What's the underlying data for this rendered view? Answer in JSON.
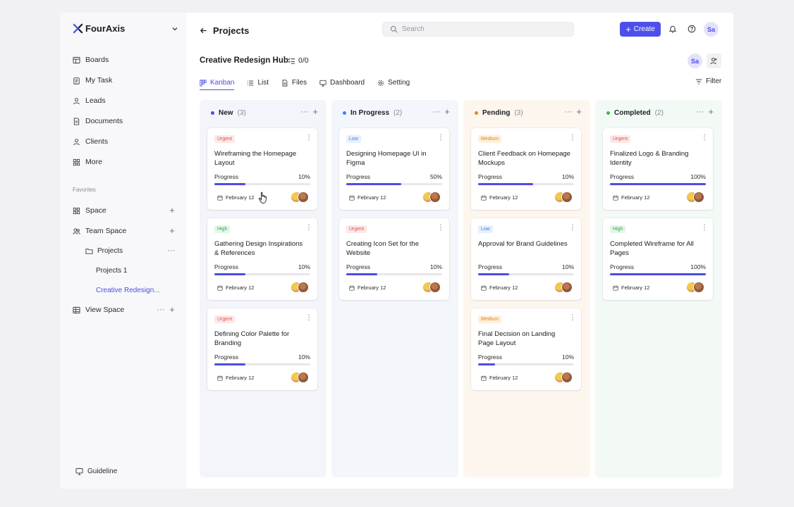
{
  "brand": {
    "name": "FourAxis"
  },
  "sidebar": {
    "items": [
      {
        "label": "Boards",
        "icon": "board-icon"
      },
      {
        "label": "My Task",
        "icon": "clipboard-icon"
      },
      {
        "label": "Leads",
        "icon": "user-icon"
      },
      {
        "label": "Documents",
        "icon": "document-icon"
      },
      {
        "label": "Clients",
        "icon": "user-icon"
      },
      {
        "label": "More",
        "icon": "grid-icon"
      }
    ],
    "favorites_label": "Favorites",
    "space": "Space",
    "team_space": "Team Space",
    "projects_folder": "Projects",
    "projects_1": "Projects 1",
    "active_project": "Creative Redesign...",
    "view_space": "View Space",
    "guideline": "Guideline"
  },
  "header": {
    "back_title": "Projects",
    "search_placeholder": "Search",
    "create_label": "Create",
    "user_initials": "Sa"
  },
  "project": {
    "title": "Creative Redesign Hub",
    "task_count": "0/0",
    "member_initials": "Sa"
  },
  "tabs": [
    {
      "label": "Kanban",
      "active": true
    },
    {
      "label": "List",
      "active": false
    },
    {
      "label": "Files",
      "active": false
    },
    {
      "label": "Dashboard",
      "active": false
    },
    {
      "label": "Setting",
      "active": false
    }
  ],
  "filter_label": "Filter",
  "colors": {
    "accent": "#4b4de0",
    "new": "#4b4de0",
    "in_progress": "#3b82f6",
    "pending": "#e08a1e",
    "completed": "#3fb950",
    "urgent_bg": "#fde8e8",
    "urgent_fg": "#e0524f",
    "high_bg": "#e4f6e7",
    "high_fg": "#34a853",
    "medium_bg": "#fdf0dc",
    "medium_fg": "#d9861a",
    "low_bg": "#e6f0fd",
    "low_fg": "#3b7de0"
  },
  "columns": [
    {
      "name": "New",
      "count": "(3)",
      "cards": [
        {
          "priority": "Urgent",
          "title": "Wireframing the Homepage Layout",
          "progress_label": "Progress",
          "progress": "10%",
          "progress_value": 0.32,
          "date": "February 12"
        },
        {
          "priority": "High",
          "title": "Gathering Design Inspirations & References",
          "progress_label": "Progress",
          "progress": "10%",
          "progress_value": 0.32,
          "date": "February 12"
        },
        {
          "priority": "Urgent",
          "title": "Defining Color Palette for Branding",
          "progress_label": "Progress",
          "progress": "10%",
          "progress_value": 0.32,
          "date": "February 12"
        }
      ]
    },
    {
      "name": "In Progress",
      "count": "(2)",
      "cards": [
        {
          "priority": "Low",
          "title": "Designing Homepage UI in Figma",
          "progress_label": "Progress",
          "progress": "50%",
          "progress_value": 0.57,
          "date": "February 12"
        },
        {
          "priority": "Urgent",
          "title": "Creating Icon Set for the Website",
          "progress_label": "Progress",
          "progress": "10%",
          "progress_value": 0.32,
          "date": "February 12"
        }
      ]
    },
    {
      "name": "Pending",
      "count": "(3)",
      "cards": [
        {
          "priority": "Medium",
          "title": "Client Feedback on Homepage Mockups",
          "progress_label": "Progress",
          "progress": "10%",
          "progress_value": 0.57,
          "date": "February 12"
        },
        {
          "priority": "Low",
          "title": "Approval for Brand Guidelines",
          "progress_label": "Progress",
          "progress": "10%",
          "progress_value": 0.32,
          "date": "February 12"
        },
        {
          "priority": "Medium",
          "title": "Final Decision on Landing Page Layout",
          "progress_label": "Progress",
          "progress": "10%",
          "progress_value": 0.18,
          "date": "February 12"
        }
      ]
    },
    {
      "name": "Completed",
      "count": "(2)",
      "cards": [
        {
          "priority": "Urgent",
          "title": "Finalized Logo & Branding Identity",
          "progress_label": "Progress",
          "progress": "100%",
          "progress_value": 1.0,
          "date": "February 12"
        },
        {
          "priority": "High",
          "title": "Completed Wireframe for All Pages",
          "progress_label": "Progress",
          "progress": "100%",
          "progress_value": 1.0,
          "date": "February 12"
        }
      ]
    }
  ]
}
